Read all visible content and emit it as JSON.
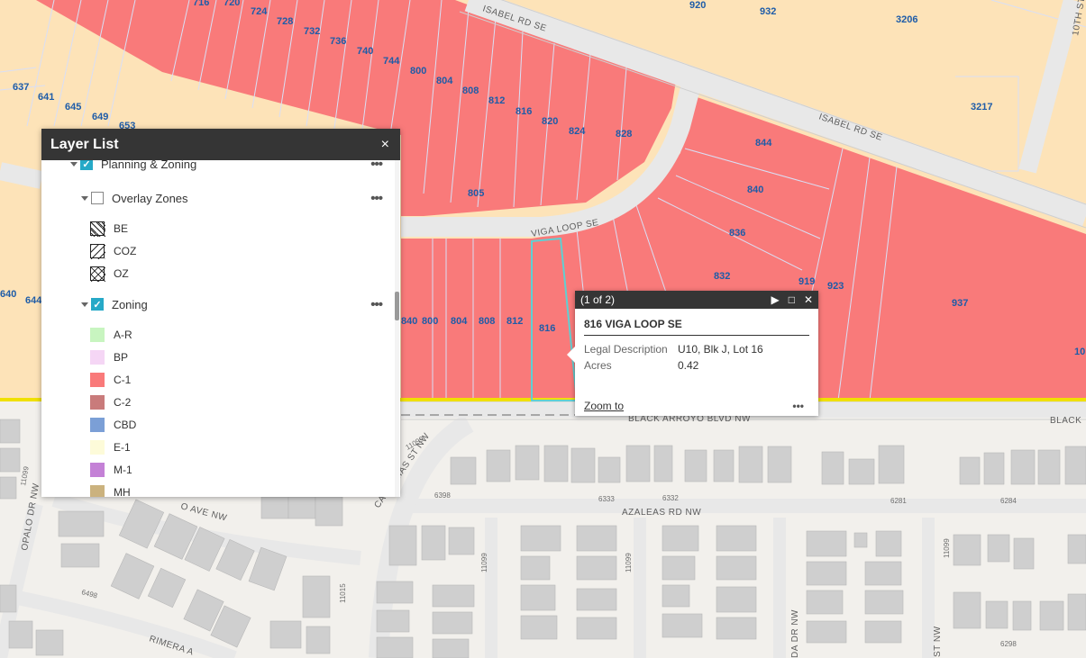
{
  "colors": {
    "residential": "#fde3b8",
    "commercial": "#f97a7a",
    "street": "#e6e6e6",
    "building": "#cfcfcf",
    "boundary_yellow": "#f0e000",
    "selection": "#5fd0d3",
    "parcel_line": "#a9b8e6",
    "accent_check": "#26a9c7"
  },
  "map": {
    "parcels": {
      "north_row": [
        "716",
        "720",
        "724",
        "728",
        "732",
        "736",
        "740",
        "744",
        "800",
        "804",
        "808",
        "812",
        "816",
        "820",
        "824",
        "828"
      ],
      "west": [
        "637",
        "641",
        "645",
        "649",
        "653"
      ],
      "east": [
        "844",
        "840",
        "836",
        "832",
        "919",
        "923",
        "937",
        "3206",
        "3217",
        "920",
        "932"
      ],
      "south_row": [
        "640",
        "644",
        "840",
        "800",
        "804",
        "808",
        "812",
        "816"
      ],
      "other": [
        "805",
        "10"
      ]
    },
    "streets": {
      "isabel_top": "ISABEL RD SE",
      "isabel": "ISABEL RD SE",
      "viga": "VIGA LOOP SE",
      "black_arroyo": "BLACK ARROYO BLVD NW",
      "black": "BLACK",
      "azaleas": "AZALEAS RD NW",
      "calcarias": "CALCARIAS ST NW",
      "opalo": "OPALO DR NW",
      "ave": "O AVE NW",
      "rimera": "RIMERA A",
      "tenth": "10TH ST",
      "st_nw": "ST NW",
      "da_dr": "DA DR NW"
    },
    "addresses": [
      "11099",
      "6398",
      "6333",
      "6332",
      "6281",
      "6284",
      "11099",
      "11015",
      "6498",
      "11099",
      "11099",
      "11099",
      "6298"
    ]
  },
  "layer_list": {
    "title": "Layer List",
    "close_icon": "×",
    "more_icon": "•••",
    "items": [
      {
        "label": "Planning & Zoning",
        "checked": true
      },
      {
        "label": "Overlay Zones",
        "checked": false
      },
      {
        "label": "Zoning",
        "checked": true
      }
    ],
    "overlay_legend": [
      {
        "label": "BE",
        "pattern": "diag-back"
      },
      {
        "label": "COZ",
        "pattern": "diag-fwd"
      },
      {
        "label": "OZ",
        "pattern": "cross"
      }
    ],
    "zoning_legend": [
      {
        "label": "A-R",
        "color": "#c8f5c0"
      },
      {
        "label": "BP",
        "color": "#f5d6f5"
      },
      {
        "label": "C-1",
        "color": "#f97a7a"
      },
      {
        "label": "C-2",
        "color": "#c97b7b"
      },
      {
        "label": "CBD",
        "color": "#7b9fd6"
      },
      {
        "label": "E-1",
        "color": "#fdfbd9"
      },
      {
        "label": "M-1",
        "color": "#c481d6"
      },
      {
        "label": "MH",
        "color": "#cbb27e"
      }
    ]
  },
  "popup": {
    "counter": "(1 of 2)",
    "title": "816 VIGA LOOP SE",
    "fields": [
      {
        "key": "Legal Description",
        "value": "U10, Blk J, Lot 16"
      },
      {
        "key": "Acres",
        "value": "0.42"
      }
    ],
    "zoom_label": "Zoom to",
    "more": "•••",
    "next_icon": "▶",
    "max_icon": "□",
    "close_icon": "✕"
  }
}
